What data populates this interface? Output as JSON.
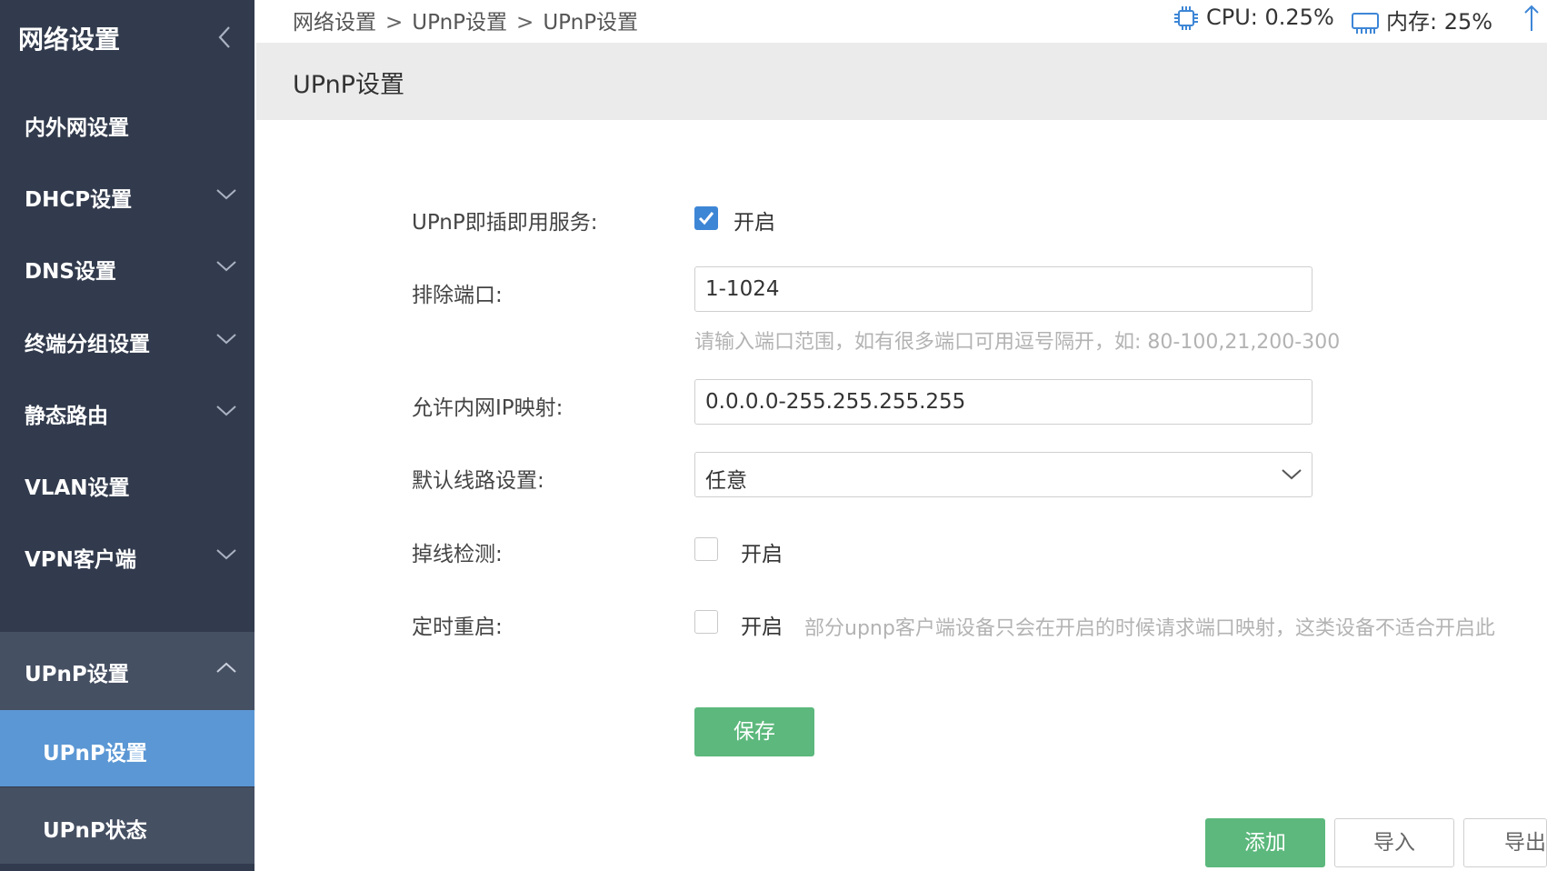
{
  "sidebar": {
    "title": "网络设置",
    "items": [
      {
        "label": "内外网设置"
      },
      {
        "label": "DHCP设置"
      },
      {
        "label": "DNS设置"
      },
      {
        "label": "终端分组设置"
      },
      {
        "label": "静态路由"
      },
      {
        "label": "VLAN设置"
      },
      {
        "label": "VPN客户端"
      },
      {
        "label": "UPnP设置"
      }
    ],
    "subitems": [
      {
        "label": "UPnP设置"
      },
      {
        "label": "UPnP状态"
      }
    ]
  },
  "breadcrumb": {
    "items": [
      "网络设置",
      "UPnP设置",
      "UPnP设置"
    ],
    "separator": ">"
  },
  "status": {
    "cpu": "CPU: 0.25%",
    "memory": "内存: 25%"
  },
  "section": {
    "title": "UPnP设置"
  },
  "form": {
    "upnp_service": {
      "label": "UPnP即插即用服务:",
      "option": "开启",
      "checked": true
    },
    "exclude_ports": {
      "label": "排除端口:",
      "value": "1-1024",
      "hint": "请输入端口范围，如有很多端口可用逗号隔开，如:  80-100,21,200-300"
    },
    "allow_ip": {
      "label": "允许内网IP映射:",
      "value": "0.0.0.0-255.255.255.255"
    },
    "default_line": {
      "label": "默认线路设置:",
      "value": "任意"
    },
    "drop_detect": {
      "label": "掉线检测:",
      "option": "开启",
      "checked": false
    },
    "timed_restart": {
      "label": "定时重启:",
      "option": "开启",
      "checked": false,
      "hint": "部分upnp客户端设备只会在开启的时候请求端口映射，这类设备不适合开启此"
    },
    "save_label": "保存"
  },
  "actions": {
    "add_label": "添加",
    "import_label": "导入",
    "export_label": "导出"
  },
  "colors": {
    "sidebar_bg": "#323b4d",
    "sidebar_open_bg": "#465063",
    "sidebar_active_bg": "#5b97d4",
    "accent_green": "#5cb87c",
    "checkbox_blue": "#3d86d6"
  }
}
